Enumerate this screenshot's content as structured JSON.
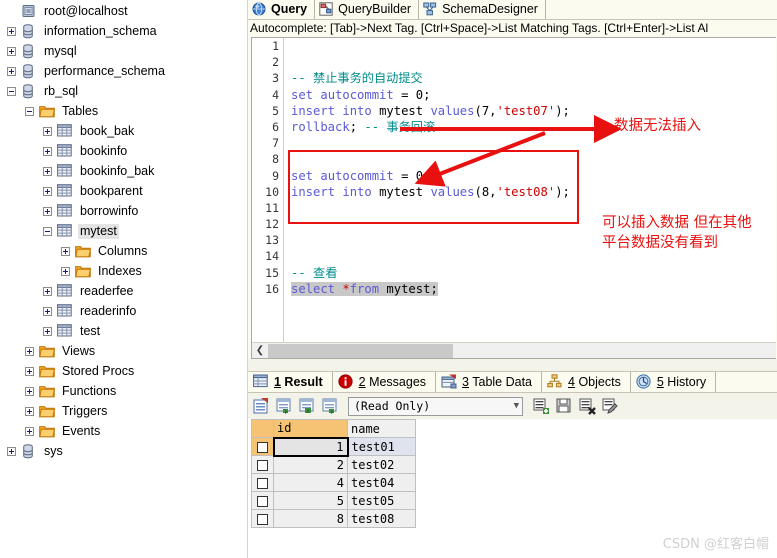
{
  "tree": {
    "root": {
      "label": "root@localhost",
      "icon": "server-icon",
      "expander": "none"
    },
    "items": [
      {
        "label": "information_schema",
        "icon": "database-icon",
        "expander": "plus",
        "indent": 0,
        "selected": false
      },
      {
        "label": "mysql",
        "icon": "database-icon",
        "expander": "plus",
        "indent": 0,
        "selected": false
      },
      {
        "label": "performance_schema",
        "icon": "database-icon",
        "expander": "plus",
        "indent": 0,
        "selected": false
      },
      {
        "label": "rb_sql",
        "icon": "database-icon",
        "expander": "minus",
        "indent": 0,
        "selected": false
      },
      {
        "label": "Tables",
        "icon": "folder-icon",
        "expander": "minus",
        "indent": 1,
        "selected": false
      },
      {
        "label": "book_bak",
        "icon": "table-icon",
        "expander": "plus",
        "indent": 2,
        "selected": false
      },
      {
        "label": "bookinfo",
        "icon": "table-icon",
        "expander": "plus",
        "indent": 2,
        "selected": false
      },
      {
        "label": "bookinfo_bak",
        "icon": "table-icon",
        "expander": "plus",
        "indent": 2,
        "selected": false
      },
      {
        "label": "bookparent",
        "icon": "table-icon",
        "expander": "plus",
        "indent": 2,
        "selected": false
      },
      {
        "label": "borrowinfo",
        "icon": "table-icon",
        "expander": "plus",
        "indent": 2,
        "selected": false
      },
      {
        "label": "mytest",
        "icon": "table-icon",
        "expander": "minus",
        "indent": 2,
        "selected": true
      },
      {
        "label": "Columns",
        "icon": "folder-icon",
        "expander": "plus",
        "indent": 3,
        "selected": false
      },
      {
        "label": "Indexes",
        "icon": "folder-icon",
        "expander": "plus",
        "indent": 3,
        "selected": false
      },
      {
        "label": "readerfee",
        "icon": "table-icon",
        "expander": "plus",
        "indent": 2,
        "selected": false
      },
      {
        "label": "readerinfo",
        "icon": "table-icon",
        "expander": "plus",
        "indent": 2,
        "selected": false
      },
      {
        "label": "test",
        "icon": "table-icon",
        "expander": "plus",
        "indent": 2,
        "selected": false
      },
      {
        "label": "Views",
        "icon": "folder-icon",
        "expander": "plus",
        "indent": 1,
        "selected": false
      },
      {
        "label": "Stored Procs",
        "icon": "folder-icon",
        "expander": "plus",
        "indent": 1,
        "selected": false
      },
      {
        "label": "Functions",
        "icon": "folder-icon",
        "expander": "plus",
        "indent": 1,
        "selected": false
      },
      {
        "label": "Triggers",
        "icon": "folder-icon",
        "expander": "plus",
        "indent": 1,
        "selected": false
      },
      {
        "label": "Events",
        "icon": "folder-icon",
        "expander": "plus",
        "indent": 1,
        "selected": false
      },
      {
        "label": "sys",
        "icon": "database-icon",
        "expander": "plus",
        "indent": 0,
        "selected": false
      }
    ]
  },
  "top_tabs": [
    {
      "label": "Query",
      "icon": "globe-icon",
      "active": true
    },
    {
      "label": "QueryBuilder",
      "icon": "querybuilder-icon",
      "active": false
    },
    {
      "label": "SchemaDesigner",
      "icon": "schemadesigner-icon",
      "active": false
    }
  ],
  "hint": "Autocomplete: [Tab]->Next Tag. [Ctrl+Space]->List Matching Tags. [Ctrl+Enter]->List Al",
  "editor": {
    "line_numbers": [
      "1",
      "2",
      "3",
      "4",
      "5",
      "6",
      "7",
      "8",
      "9",
      "10",
      "11",
      "12",
      "13",
      "14",
      "15",
      "16"
    ],
    "lines": [
      "",
      "",
      "-- 禁止事务的自动提交",
      "set autocommit = 0;",
      "insert into mytest values(7,'test07');",
      "rollback; -- 事务回滚",
      "",
      "",
      "set autocommit = 0;",
      "insert into mytest values(8,'test08');",
      "",
      "",
      "",
      "",
      "-- 查看",
      "select *from mytest;"
    ]
  },
  "annotations": {
    "red_color": "#e8110f",
    "note_1": "数据无法插入",
    "note_2_line1": "可以插入数据 但在其他",
    "note_2_line2": "平台数据没有看到"
  },
  "result_tabs": [
    {
      "num": "1",
      "label": "Result",
      "icon": "grid-icon",
      "active": true
    },
    {
      "num": "2",
      "label": "Messages",
      "icon": "info-icon",
      "active": false
    },
    {
      "num": "3",
      "label": "Table Data",
      "icon": "tabledata-icon",
      "active": false
    },
    {
      "num": "4",
      "label": "Objects",
      "icon": "objects-icon",
      "active": false
    },
    {
      "num": "5",
      "label": "History",
      "icon": "history-icon",
      "active": false
    }
  ],
  "result_toolbar": {
    "buttons_left": [
      "refresh-grid-icon",
      "export-grid-icon",
      "import-grid-icon",
      "transfer-grid-icon"
    ],
    "mode_value": "(Read Only)",
    "buttons_right": [
      "add-row-icon",
      "save-icon",
      "delete-row-icon",
      "edit-row-icon"
    ]
  },
  "grid": {
    "columns": [
      "id",
      "name"
    ],
    "rows": [
      {
        "id": "1",
        "name": "test01"
      },
      {
        "id": "2",
        "name": "test02"
      },
      {
        "id": "4",
        "name": "test04"
      },
      {
        "id": "5",
        "name": "test05"
      },
      {
        "id": "8",
        "name": "test08"
      }
    ]
  },
  "watermark": "CSDN @红客白帽"
}
